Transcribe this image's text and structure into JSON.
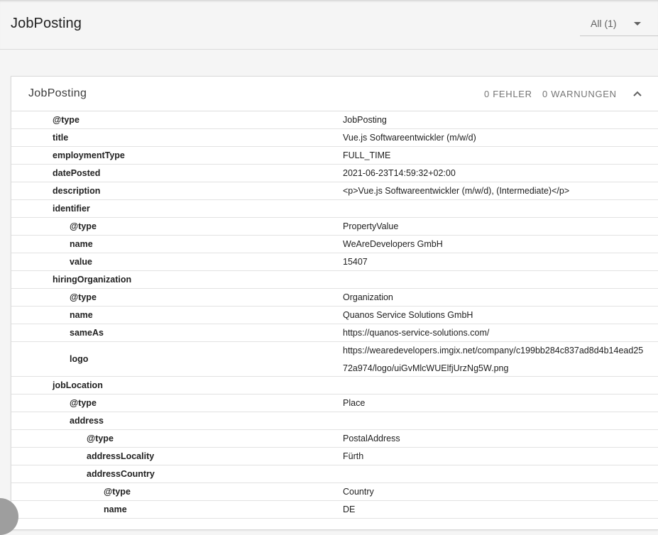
{
  "header": {
    "title": "JobPosting",
    "filter_label": "All (1)"
  },
  "card": {
    "title": "JobPosting",
    "errors": "0 FEHLER",
    "warnings": "0 WARNUNGEN"
  },
  "rows": [
    {
      "key": "@type",
      "value": "JobPosting",
      "level": 0
    },
    {
      "key": "title",
      "value": "Vue.js Softwareentwickler (m/w/d)",
      "level": 0
    },
    {
      "key": "employmentType",
      "value": "FULL_TIME",
      "level": 0
    },
    {
      "key": "datePosted",
      "value": "2021-06-23T14:59:32+02:00",
      "level": 0
    },
    {
      "key": "description",
      "value": "<p>Vue.js Softwareentwickler (m/w/d), (Intermediate)</p>",
      "level": 0
    },
    {
      "key": "identifier",
      "value": "",
      "level": 0
    },
    {
      "key": "@type",
      "value": "PropertyValue",
      "level": 1
    },
    {
      "key": "name",
      "value": "WeAreDevelopers GmbH",
      "level": 1
    },
    {
      "key": "value",
      "value": "15407",
      "level": 1
    },
    {
      "key": "hiringOrganization",
      "value": "",
      "level": 0
    },
    {
      "key": "@type",
      "value": "Organization",
      "level": 1
    },
    {
      "key": "name",
      "value": "Quanos Service Solutions GmbH",
      "level": 1
    },
    {
      "key": "sameAs",
      "value": "https://quanos-service-solutions.com/",
      "level": 1
    },
    {
      "key": "logo",
      "value": "https://wearedevelopers.imgix.net/company/c199bb284c837ad8d4b14ead2572a974/logo/uiGvMlcWUElfjUrzNg5W.png",
      "level": 1,
      "tall": true
    },
    {
      "key": "jobLocation",
      "value": "",
      "level": 0
    },
    {
      "key": "@type",
      "value": "Place",
      "level": 1
    },
    {
      "key": "address",
      "value": "",
      "level": 1
    },
    {
      "key": "@type",
      "value": "PostalAddress",
      "level": 2
    },
    {
      "key": "addressLocality",
      "value": "Fürth",
      "level": 2
    },
    {
      "key": "addressCountry",
      "value": "",
      "level": 2
    },
    {
      "key": "@type",
      "value": "Country",
      "level": 3
    },
    {
      "key": "name",
      "value": "DE",
      "level": 3
    }
  ]
}
